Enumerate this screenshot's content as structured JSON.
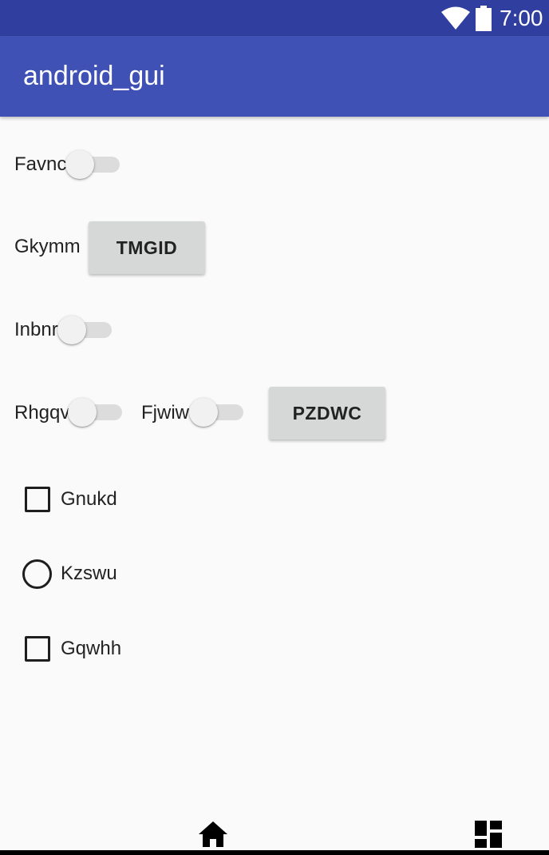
{
  "status_bar": {
    "time": "7:00",
    "icons": [
      "wifi-icon",
      "battery-icon"
    ]
  },
  "app_bar": {
    "title": "android_gui"
  },
  "rows": {
    "favnc": {
      "label": "Favnc",
      "switch_on": false
    },
    "gkymm": {
      "label": "Gkymm",
      "button_label": "TMGID"
    },
    "inbnr": {
      "label": "Inbnr",
      "switch_on": false
    },
    "rhgqv": {
      "label": "Rhgqv",
      "switch_on": false
    },
    "fjwiw": {
      "label": "Fjwiw",
      "switch_on": false
    },
    "pzdwc": {
      "button_label": "PZDWC"
    },
    "gnukd": {
      "label": "Gnukd",
      "checked": false
    },
    "kzswu": {
      "label": "Kzswu",
      "selected": false
    },
    "gqwhh": {
      "label": "Gqwhh",
      "checked": false
    }
  },
  "bottom_nav": {
    "icons": [
      "home-icon",
      "dashboard-icon"
    ]
  },
  "colors": {
    "status_bar": "#303f9f",
    "app_bar": "#3f51b5",
    "background": "#fafafa",
    "button": "#d6d7d7"
  }
}
